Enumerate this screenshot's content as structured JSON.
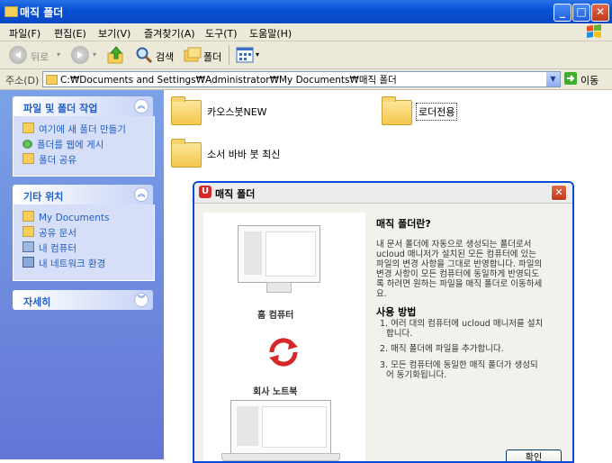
{
  "window": {
    "title": "매직 폴더",
    "min_label": "_",
    "max_label": "□",
    "close_label": "✕"
  },
  "menu": [
    "파일(F)",
    "편집(E)",
    "보기(V)",
    "즐겨찾기(A)",
    "도구(T)",
    "도움말(H)"
  ],
  "toolbar": {
    "back": "뒤로",
    "search": "검색",
    "folders": "폴더"
  },
  "address": {
    "label": "주소(D)",
    "path": "C:₩Documents and Settings₩Administrator₩My Documents₩매직 폴더",
    "go": "이동"
  },
  "left": {
    "tasks_title": "파일 및 폴더 작업",
    "tasks": [
      "여기에 새 폴더 만들기",
      "폴더를 웹에 게시",
      "폴더 공유"
    ],
    "places_title": "기타 위치",
    "places": [
      "My Documents",
      "공유 문서",
      "내 컴퓨터",
      "내 네트워크 환경"
    ],
    "details_title": "자세히"
  },
  "folders": [
    "카오스붓NEW",
    "로더전용",
    "소서 바바 붓 최신"
  ],
  "dialog": {
    "title": "매직 폴더",
    "home_pc": "홈 컴퓨터",
    "work_laptop": "회사 노트북",
    "heading": "매직 폴더란?",
    "desc": [
      "내 문서 폴더에 자동으로 생성되는 폴더로서",
      "ucloud 매니저가 설치된 모든 컴퓨터에 있는",
      "파일의 변경 사항을 그대로 반영합니다. 파일의",
      "변경 사항이 모든 컴퓨터에 동일하게 반영되도",
      "록 하려면 원하는 파일을 매직 폴더로 이동하세",
      "요."
    ],
    "usage_heading": "사용 방법",
    "steps": [
      [
        "1. 여러 대의 컴퓨터에 ucloud 매니저를 설치",
        "합니다."
      ],
      [
        "2. 매직 폴더에 파일을 추가합니다."
      ],
      [
        "3. 모든 컴퓨터에 동일한 매직 폴더가 생성되",
        "어 동기화됩니다."
      ]
    ],
    "ok": "확인"
  }
}
